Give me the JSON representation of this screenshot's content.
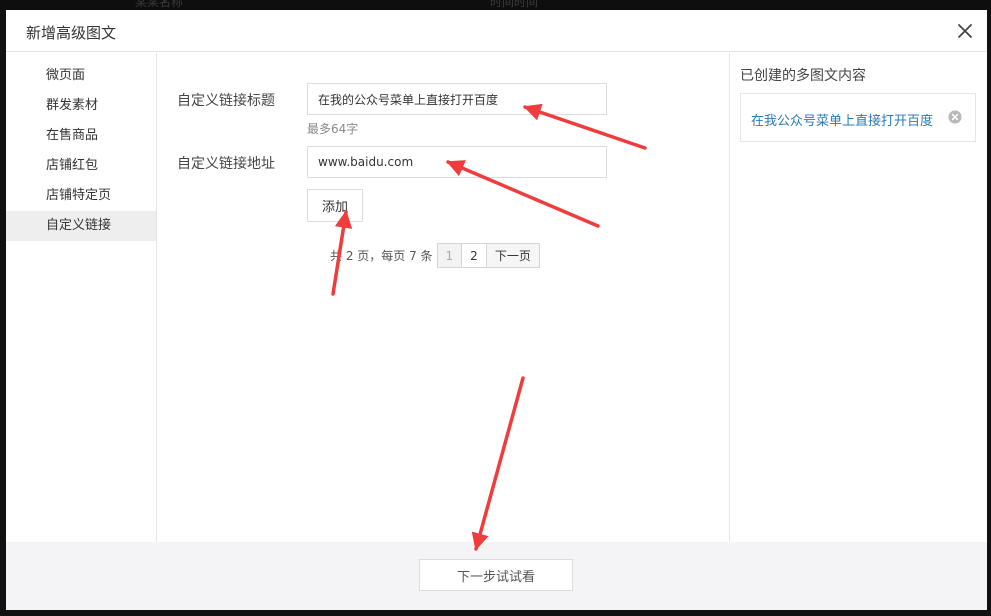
{
  "background": {
    "ghost_left": "某某名称",
    "ghost_right": "时间时间"
  },
  "dialog": {
    "title": "新增高级图文"
  },
  "sidebar": {
    "items": [
      {
        "label": "微页面"
      },
      {
        "label": "群发素材"
      },
      {
        "label": "在售商品"
      },
      {
        "label": "店铺红包"
      },
      {
        "label": "店铺特定页"
      },
      {
        "label": "自定义链接"
      }
    ],
    "active_index": 5
  },
  "form": {
    "title_label": "自定义链接标题",
    "title_value": "在我的公众号菜单上直接打开百度",
    "title_hint": "最多64字",
    "url_label": "自定义链接地址",
    "url_value": "www.baidu.com",
    "add_label": "添加"
  },
  "pagination": {
    "info": "共 2 页，每页 7 条",
    "pages": [
      "1",
      "2"
    ],
    "current_page": "1",
    "next_label": "下一页"
  },
  "created": {
    "title": "已创建的多图文内容",
    "items": [
      {
        "label": "在我公众号菜单上直接打开百度"
      }
    ]
  },
  "footer": {
    "next_step_label": "下一步试试看"
  },
  "colors": {
    "link": "#2b7ab3",
    "annotation_arrow": "#f03c3c"
  },
  "icons": {
    "close": "close-icon",
    "remove": "remove-circle-icon"
  }
}
